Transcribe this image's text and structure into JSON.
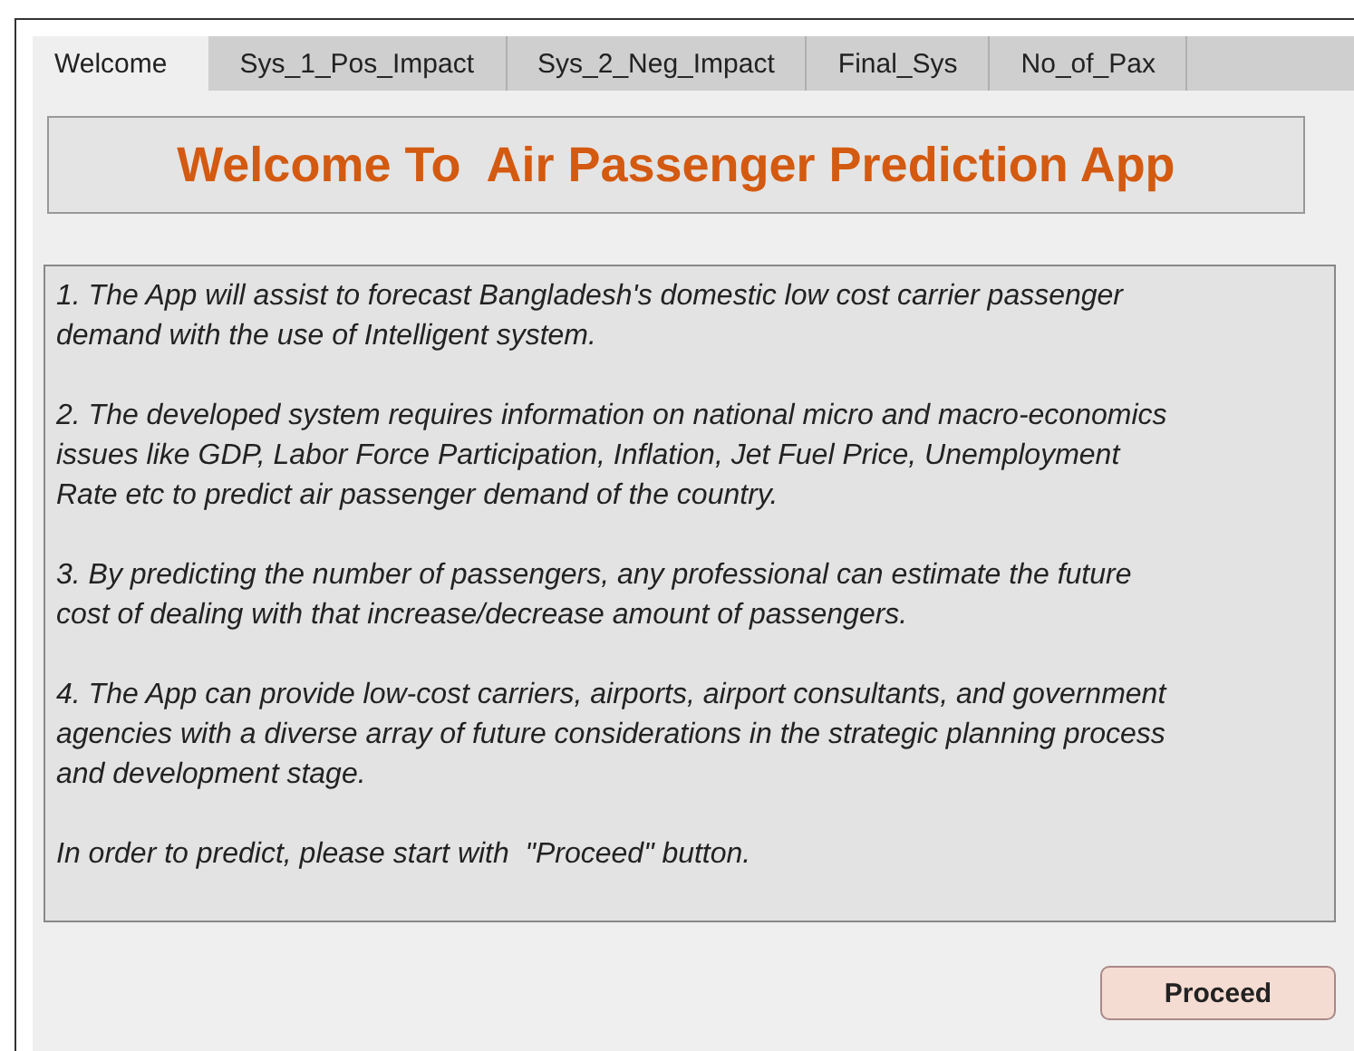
{
  "tabs": [
    {
      "label": "Welcome",
      "selected": true
    },
    {
      "label": "Sys_1_Pos_Impact",
      "selected": false
    },
    {
      "label": "Sys_2_Neg_Impact",
      "selected": false
    },
    {
      "label": "Final_Sys",
      "selected": false
    },
    {
      "label": "No_of_Pax",
      "selected": false
    }
  ],
  "title": "Welcome To  Air Passenger Prediction App",
  "paragraphs": [
    "1. The App will assist to forecast Bangladesh's domestic low cost carrier passenger\ndemand with the use of Intelligent system.",
    "2. The developed system requires information on national micro and macro-economics\nissues like GDP, Labor Force Participation, Inflation, Jet Fuel Price, Unemployment\nRate etc to predict air passenger demand of the country.",
    "3. By predicting the number of passengers, any professional can estimate the future\ncost of dealing with that increase/decrease amount of passengers.",
    "4. The App can provide low-cost carriers, airports, airport consultants, and government\nagencies with a diverse array of future considerations in the strategic planning process\nand development stage.",
    "In order to predict, please start with  \"Proceed\" button."
  ],
  "proceed_button": "Proceed"
}
